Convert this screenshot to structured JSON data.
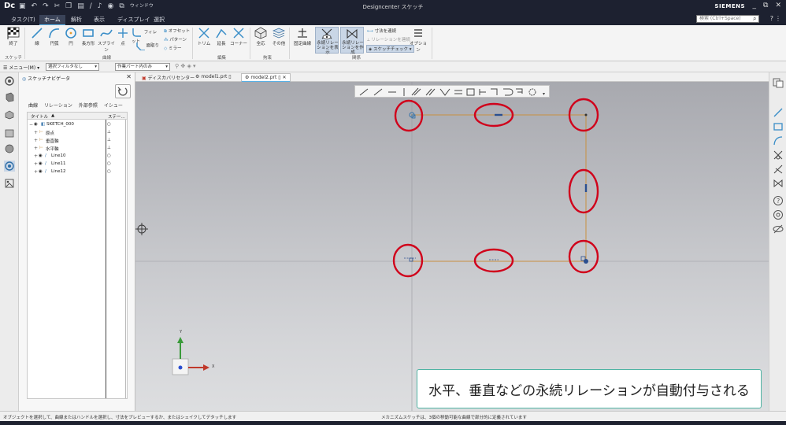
{
  "app": {
    "logo": "Dc",
    "title": "Designcenter スケッチ",
    "brand": "SIEMENS",
    "window_menu": "ウィンドウ"
  },
  "menubar": {
    "tabs": [
      "タスク(T)",
      "ホーム",
      "解析",
      "表示",
      "ディスプレイ",
      "選択"
    ],
    "active_tab": "ホーム",
    "search_placeholder": "検索 (Ctrl+Space)"
  },
  "ribbon": {
    "finish_label": "終了",
    "sketch_group_label": "スケッチ",
    "curve_group_label": "曲線",
    "edit_group_label": "編集",
    "constraint_group_label": "拘束",
    "relation_group_label": "関係",
    "curve_buttons": [
      "線",
      "円弧",
      "円",
      "長方形",
      "スプライン",
      "点",
      "フィレット",
      "面取り"
    ],
    "curve_small": [
      "オフセット",
      "パターン",
      "ミラー"
    ],
    "edit_buttons": [
      "トリム",
      "延長",
      "コーナー"
    ],
    "constraint_buttons": [
      "全応",
      "その他"
    ],
    "relation_buttons": [
      "固定曲線",
      "永続リレーションを表示",
      "永続リレーションを作成"
    ],
    "relation_small": [
      "寸法を連続",
      "リレーションを連続",
      "スケッチチェック"
    ],
    "options_label": "オプション"
  },
  "selbar": {
    "menu_label": "メニュー(M)",
    "filter_value": "選択フィルタなし",
    "scope_value": "作業パート内のみ"
  },
  "navigator": {
    "title": "スケッチナビゲータ",
    "tabs": [
      "曲線",
      "リレーション",
      "外部参照",
      "イシュー"
    ],
    "header_title": "タイトル",
    "header_status": "ステー...",
    "rows": [
      {
        "label": "SKETCH_000",
        "level": 0
      },
      {
        "label": "原点",
        "level": 1
      },
      {
        "label": "垂直軸",
        "level": 1
      },
      {
        "label": "水平軸",
        "level": 1
      },
      {
        "label": "Line10",
        "level": 1
      },
      {
        "label": "Line11",
        "level": 1
      },
      {
        "label": "Line12",
        "level": 1
      }
    ]
  },
  "doctabs": [
    {
      "label": "ディスカバリセンター",
      "active": false
    },
    {
      "label": "model1.prt",
      "active": false
    },
    {
      "label": "model2.prt",
      "active": true
    }
  ],
  "axis": {
    "x_label": "X",
    "y_label": "Y"
  },
  "caption": "水平、垂直などの永続リレーションが自動付与される",
  "status": {
    "left": "オブジェクトを選択して、曲線またはハンドルを選択し、寸法をプレビューするか、またはシェイクしてデタッチします",
    "right": "メカニズムスケッチは、3個の移動可能な曲線で部分的に定義されています"
  },
  "colors": {
    "accent": "#59b1e6",
    "sketch_line": "#c8903f",
    "highlight_ring": "#d0021b",
    "caption_border": "#4fb3a3"
  }
}
